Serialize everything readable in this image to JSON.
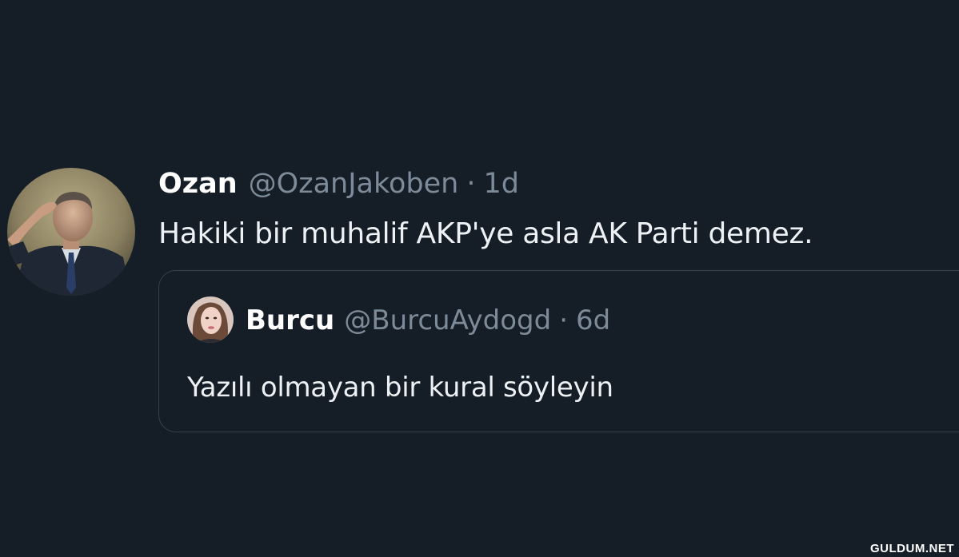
{
  "tweet": {
    "author": {
      "display_name": "Ozan",
      "handle": "@OzanJakoben",
      "avatar_icon": "user-avatar-saluting-man"
    },
    "separator": "·",
    "time": "1d",
    "text": "Hakiki bir muhalif AKP'ye asla AK Parti demez."
  },
  "quoted_tweet": {
    "author": {
      "display_name": "Burcu",
      "handle": "@BurcuAydogd",
      "avatar_icon": "user-avatar-woman"
    },
    "separator": "·",
    "time": "6d",
    "text": "Yazılı olmayan bir kural söyleyin"
  },
  "watermark": "GULDUM.NET",
  "colors": {
    "background": "#151d27",
    "primary_text": "#eef1f4",
    "secondary_text": "#7d8a98",
    "quote_border": "#36414d"
  }
}
